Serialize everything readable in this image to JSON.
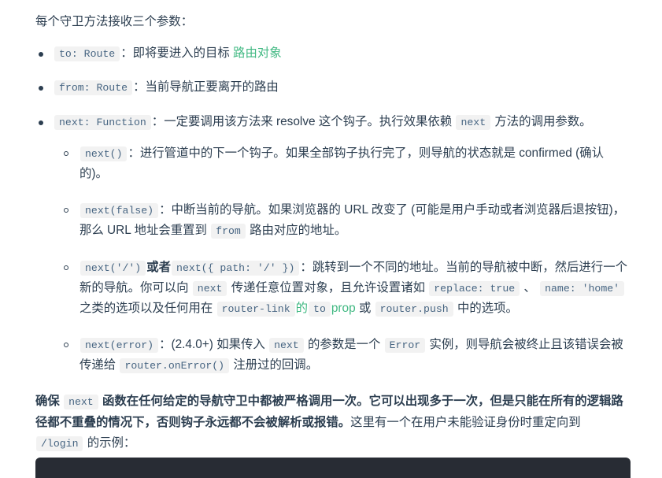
{
  "document": {
    "intro": "每个守卫方法接收三个参数：",
    "params": [
      {
        "code": "to: Route",
        "sep": "：",
        "text_before_link": "即将要进入的目标 ",
        "link": "路由对象",
        "text_after_link": ""
      },
      {
        "code": "from: Route",
        "sep": "：",
        "text": "当前导航正要离开的路由"
      },
      {
        "code": "next: Function",
        "sep": "：",
        "text_part1": "一定要调用该方法来 resolve 这个钩子。执行效果依赖 ",
        "inline_code": "next",
        "text_part2": " 方法的调用参数。"
      }
    ],
    "next_options": [
      {
        "code": "next()",
        "sep": "：",
        "text": "进行管道中的下一个钩子。如果全部钩子执行完了，则导航的状态就是 confirmed (确认的)。"
      },
      {
        "code": "next(false)",
        "sep": "：",
        "text_part1": "中断当前的导航。如果浏览器的 URL 改变了 (可能是用户手动或者浏览器后退按钮)，那么 URL 地址会重置到 ",
        "inline_code": "from",
        "text_part2": " 路由对应的地址。"
      },
      {
        "code_a": "next('/')",
        "or_label": "或者",
        "code_b": "next({ path: '/' })",
        "sep": "：",
        "text_part1": "跳转到一个不同的地址。当前的导航被中断，然后进行一个新的导航。你可以向 ",
        "inline_code_1": "next",
        "text_part2": " 传递任意位置对象，且允许设置诸如 ",
        "inline_code_2": "replace: true",
        "text_part3": " 、 ",
        "inline_code_3": "name: 'home'",
        "text_part4": " 之类的选项以及任何用在 ",
        "inline_code_4": "router-link",
        "link_1": "的",
        "inline_code_5": "to",
        "link_2": "prop",
        "text_part5": " 或 ",
        "inline_code_6": "router.push",
        "text_part6": " 中的选项。"
      },
      {
        "code": "next(error)",
        "sep": "：",
        "text_part1": "(2.4.0+) 如果传入 ",
        "inline_code_1": "next",
        "text_part2": " 的参数是一个 ",
        "inline_code_2": "Error",
        "text_part3": " 实例，则导航会被终止且该错误会被传递给 ",
        "inline_code_3": "router.onError()",
        "text_part4": " 注册过的回调。"
      }
    ],
    "note": {
      "bold_part1": "确保 ",
      "bold_code": "next",
      "bold_part2": " 函数在任何给定的导航守卫中都被严格调用一次。它可以出现多于一次，但是只能在所有的逻辑路径都不重叠的情况下，否则钩子永远都不会被解析或报错。",
      "normal_part1": "这里有一个在用户未能验证身份时重定向到 ",
      "normal_code": "/login",
      "normal_part2": " 的示例："
    }
  },
  "colors": {
    "text": "#2c3e50",
    "link": "#42b983",
    "code_text": "#476582",
    "code_bg": "#f2f2f2",
    "codeblock_bg": "#282c34",
    "page_bg": "#ffffff"
  }
}
